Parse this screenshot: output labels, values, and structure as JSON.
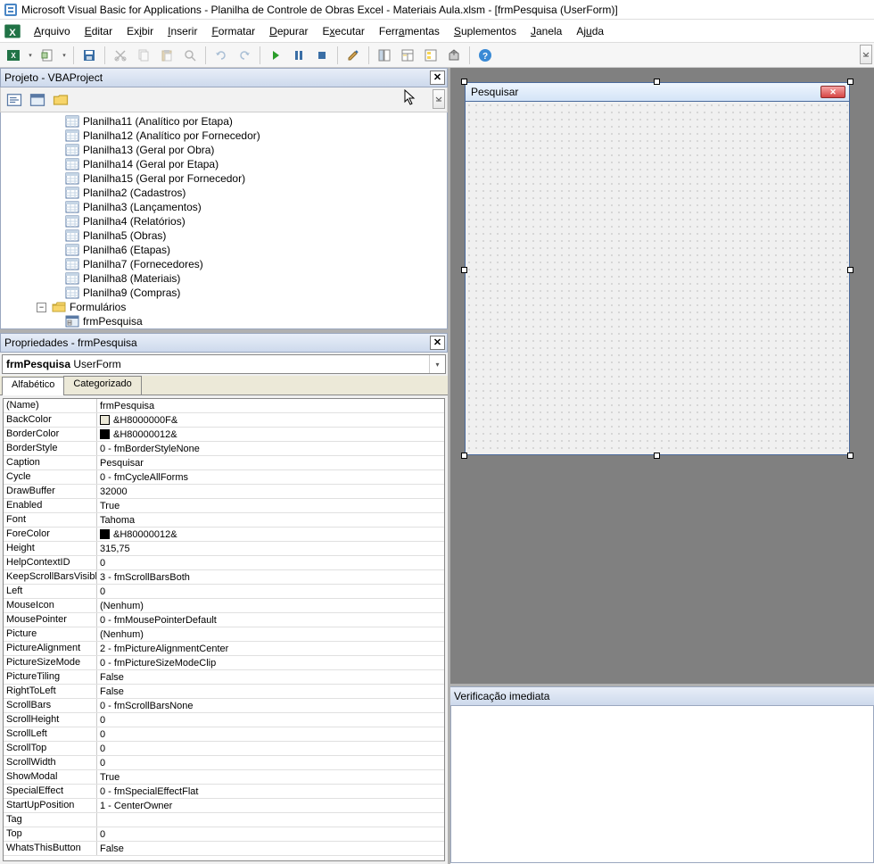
{
  "title": "Microsoft Visual Basic for Applications - Planilha de Controle de Obras Excel - Materiais Aula.xlsm - [frmPesquisa (UserForm)]",
  "menus": [
    "Arquivo",
    "Editar",
    "Exibir",
    "Inserir",
    "Formatar",
    "Depurar",
    "Executar",
    "Ferramentas",
    "Suplementos",
    "Janela",
    "Ajuda"
  ],
  "menu_underline_idx": [
    0,
    0,
    2,
    0,
    0,
    0,
    1,
    4,
    0,
    0,
    2
  ],
  "project_panel_title": "Projeto - VBAProject",
  "tree_items": [
    {
      "label": "Planilha11 (Analítico por Etapa)",
      "type": "sheet"
    },
    {
      "label": "Planilha12 (Analítico por Fornecedor)",
      "type": "sheet"
    },
    {
      "label": "Planilha13 (Geral por Obra)",
      "type": "sheet"
    },
    {
      "label": "Planilha14 (Geral por Etapa)",
      "type": "sheet"
    },
    {
      "label": "Planilha15 (Geral por Fornecedor)",
      "type": "sheet"
    },
    {
      "label": "Planilha2 (Cadastros)",
      "type": "sheet"
    },
    {
      "label": "Planilha3 (Lançamentos)",
      "type": "sheet"
    },
    {
      "label": "Planilha4 (Relatórios)",
      "type": "sheet"
    },
    {
      "label": "Planilha5 (Obras)",
      "type": "sheet"
    },
    {
      "label": "Planilha6 (Etapas)",
      "type": "sheet"
    },
    {
      "label": "Planilha7 (Fornecedores)",
      "type": "sheet"
    },
    {
      "label": "Planilha8 (Materiais)",
      "type": "sheet"
    },
    {
      "label": "Planilha9 (Compras)",
      "type": "sheet"
    },
    {
      "label": "Formulários",
      "type": "folder"
    },
    {
      "label": "frmPesquisa",
      "type": "form"
    }
  ],
  "props_panel_title": "Propriedades - frmPesquisa",
  "props_dropdown_name": "frmPesquisa",
  "props_dropdown_type": "UserForm",
  "tabs": {
    "alpha": "Alfabético",
    "cat": "Categorizado"
  },
  "props": [
    {
      "name": "(Name)",
      "value": "frmPesquisa"
    },
    {
      "name": "BackColor",
      "value": "&H8000000F&",
      "swatch": "#ece9d8"
    },
    {
      "name": "BorderColor",
      "value": "&H80000012&",
      "swatch": "#000000"
    },
    {
      "name": "BorderStyle",
      "value": "0 - fmBorderStyleNone"
    },
    {
      "name": "Caption",
      "value": "Pesquisar"
    },
    {
      "name": "Cycle",
      "value": "0 - fmCycleAllForms"
    },
    {
      "name": "DrawBuffer",
      "value": "32000"
    },
    {
      "name": "Enabled",
      "value": "True"
    },
    {
      "name": "Font",
      "value": "Tahoma"
    },
    {
      "name": "ForeColor",
      "value": "&H80000012&",
      "swatch": "#000000"
    },
    {
      "name": "Height",
      "value": "315,75"
    },
    {
      "name": "HelpContextID",
      "value": "0"
    },
    {
      "name": "KeepScrollBarsVisible",
      "value": "3 - fmScrollBarsBoth"
    },
    {
      "name": "Left",
      "value": "0"
    },
    {
      "name": "MouseIcon",
      "value": "(Nenhum)"
    },
    {
      "name": "MousePointer",
      "value": "0 - fmMousePointerDefault"
    },
    {
      "name": "Picture",
      "value": "(Nenhum)"
    },
    {
      "name": "PictureAlignment",
      "value": "2 - fmPictureAlignmentCenter"
    },
    {
      "name": "PictureSizeMode",
      "value": "0 - fmPictureSizeModeClip"
    },
    {
      "name": "PictureTiling",
      "value": "False"
    },
    {
      "name": "RightToLeft",
      "value": "False"
    },
    {
      "name": "ScrollBars",
      "value": "0 - fmScrollBarsNone"
    },
    {
      "name": "ScrollHeight",
      "value": "0"
    },
    {
      "name": "ScrollLeft",
      "value": "0"
    },
    {
      "name": "ScrollTop",
      "value": "0"
    },
    {
      "name": "ScrollWidth",
      "value": "0"
    },
    {
      "name": "ShowModal",
      "value": "True"
    },
    {
      "name": "SpecialEffect",
      "value": "0 - fmSpecialEffectFlat"
    },
    {
      "name": "StartUpPosition",
      "value": "1 - CenterOwner"
    },
    {
      "name": "Tag",
      "value": ""
    },
    {
      "name": "Top",
      "value": "0"
    },
    {
      "name": "WhatsThisButton",
      "value": "False"
    }
  ],
  "userform_caption": "Pesquisar",
  "immediate_title": "Verificação imediata"
}
